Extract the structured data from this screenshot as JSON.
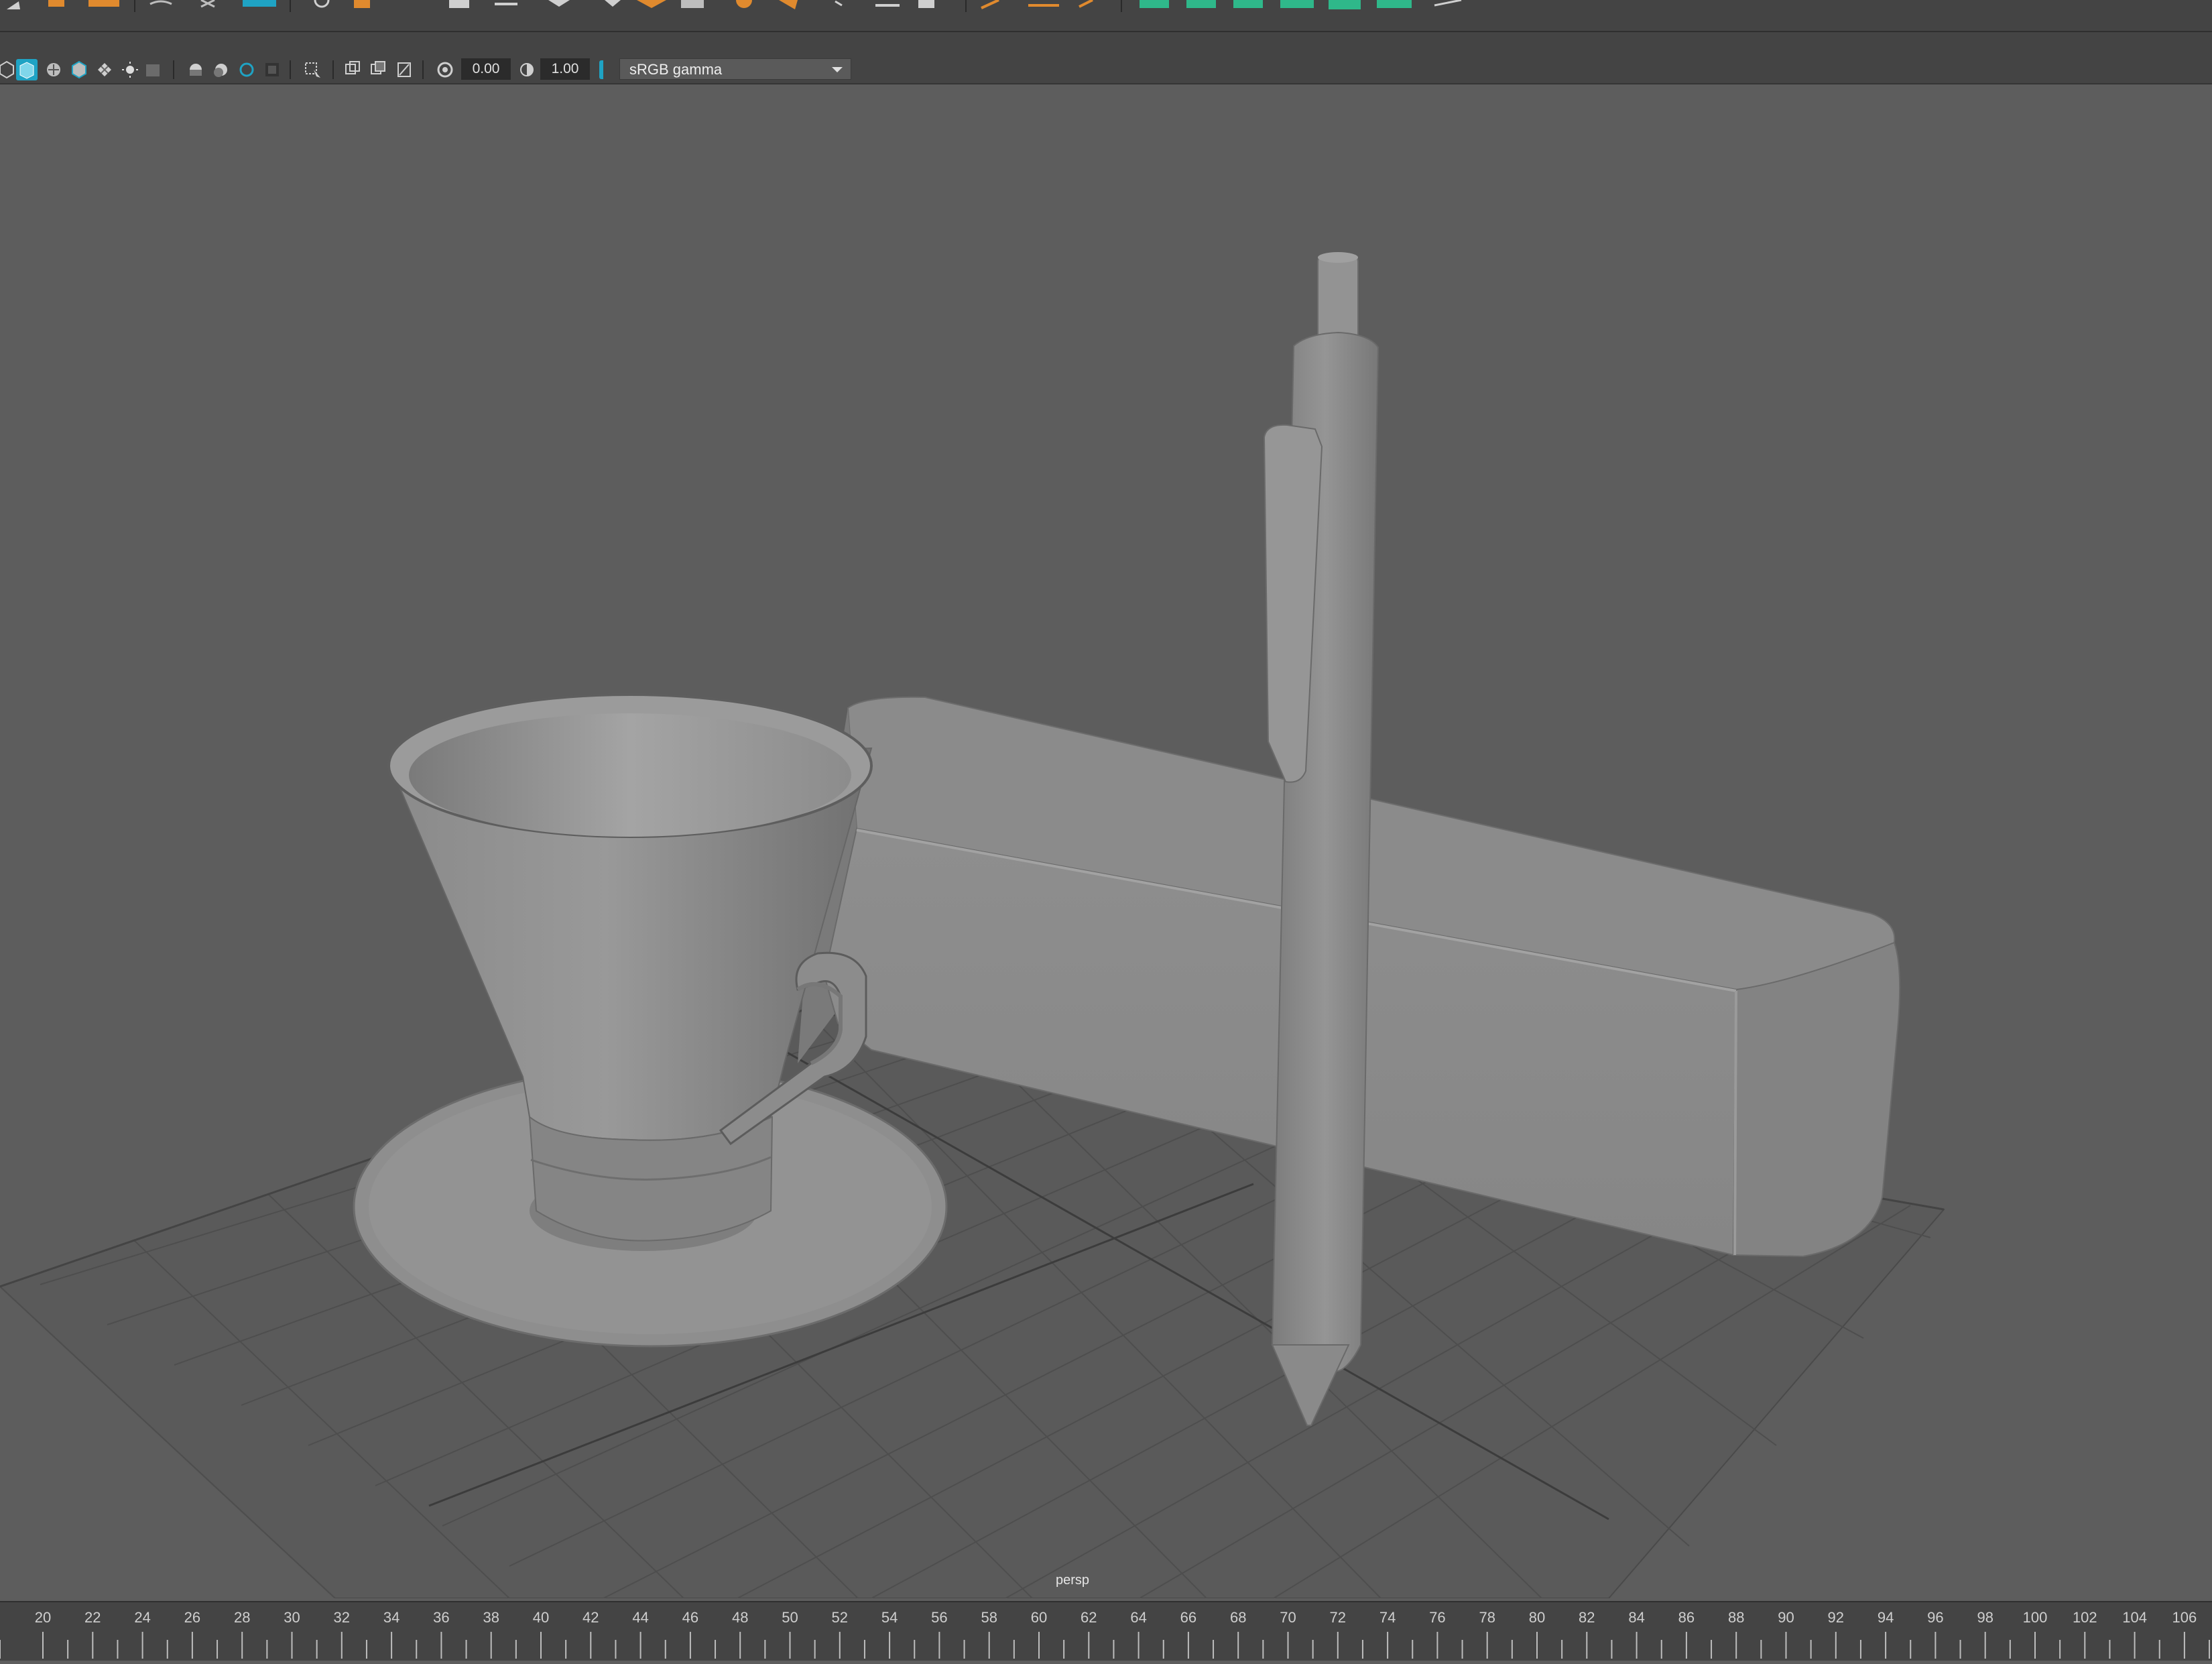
{
  "panel_toolbar": {
    "exposure_value": "0.00",
    "gamma_value": "1.00",
    "color_management": "sRGB gamma"
  },
  "viewport": {
    "camera_label": "persp"
  },
  "timeline": {
    "ticks": [
      "20",
      "22",
      "24",
      "26",
      "28",
      "30",
      "32",
      "34",
      "36",
      "38",
      "40",
      "42",
      "44",
      "46",
      "48",
      "50",
      "52",
      "54",
      "56",
      "58",
      "60",
      "62",
      "64",
      "66",
      "68",
      "70",
      "72",
      "74",
      "76",
      "78",
      "80",
      "82",
      "84",
      "86",
      "88",
      "90",
      "92",
      "94",
      "96",
      "98",
      "100",
      "102",
      "104",
      "106"
    ]
  },
  "colors": {
    "accent_blue": "#1fa3c4",
    "accent_orange": "#e08a2e",
    "accent_green": "#2fb88a",
    "ui_panel": "#444444",
    "viewport_bg": "#5d5d5d"
  }
}
